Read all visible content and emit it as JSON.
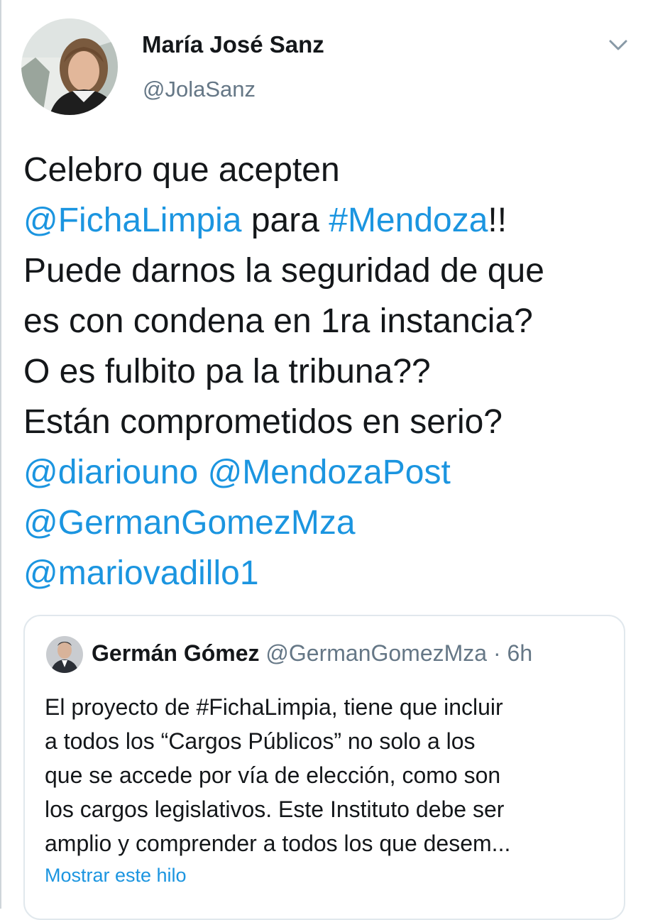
{
  "tweet": {
    "author": {
      "name": "María José Sanz",
      "handle": "@JolaSanz"
    },
    "menu_icon": "chevron-down-icon",
    "lines": [
      [
        {
          "text": "Celebro que acepten",
          "type": "text"
        }
      ],
      [
        {
          "text": "@FichaLimpia",
          "type": "mention"
        },
        {
          "text": " para ",
          "type": "text"
        },
        {
          "text": "#Mendoza",
          "type": "hashtag"
        },
        {
          "text": "!!",
          "type": "text"
        }
      ],
      [
        {
          "text": "Puede darnos la seguridad de que",
          "type": "text"
        }
      ],
      [
        {
          "text": "es con condena en 1ra instancia?",
          "type": "text"
        }
      ],
      [
        {
          "text": "O es fulbito pa la tribuna??",
          "type": "text"
        }
      ],
      [
        {
          "text": "Están comprometidos en serio?",
          "type": "text"
        }
      ],
      [
        {
          "text": "@diariouno",
          "type": "mention"
        },
        {
          "text": " ",
          "type": "text"
        },
        {
          "text": "@MendozaPost",
          "type": "mention"
        }
      ],
      [
        {
          "text": "@GermanGomezMza",
          "type": "mention"
        }
      ],
      [
        {
          "text": "@mariovadillo1",
          "type": "mention"
        }
      ]
    ]
  },
  "quoted_tweet": {
    "author": {
      "name": "Germán Gómez",
      "handle": "@GermanGomezMza",
      "separator": " · ",
      "time": "6h"
    },
    "lines": [
      "El proyecto de #FichaLimpia, tiene que incluir",
      "a todos los “Cargos Públicos” no solo a los",
      "que se accede por vía de elección, como son",
      "los cargos legislativos. Este Instituto debe ser",
      "amplio y comprender a todos los que desem..."
    ],
    "show_thread": "Mostrar este hilo"
  },
  "colors": {
    "link": "#1b95e0",
    "text": "#14171a",
    "secondary": "#657786",
    "border": "#e1e8ed"
  }
}
